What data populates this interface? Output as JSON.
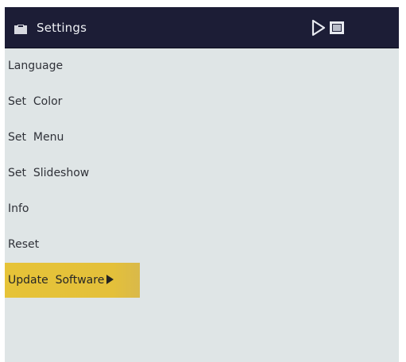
{
  "header": {
    "title": "Settings",
    "icons": [
      "folder-icon",
      "play-icon",
      "display-icon"
    ]
  },
  "menu": {
    "items": [
      {
        "label": "Language"
      },
      {
        "label": "Set  Color"
      },
      {
        "label": "Set  Menu"
      },
      {
        "label": "Set  Slideshow"
      },
      {
        "label": "Info"
      },
      {
        "label": "Reset"
      },
      {
        "label": "Update  Software",
        "selected": true
      }
    ]
  },
  "colors": {
    "titlebar": "#1c1d36",
    "background": "#dfe5e6",
    "selection": "#e6c338",
    "text": "#2f3138"
  }
}
